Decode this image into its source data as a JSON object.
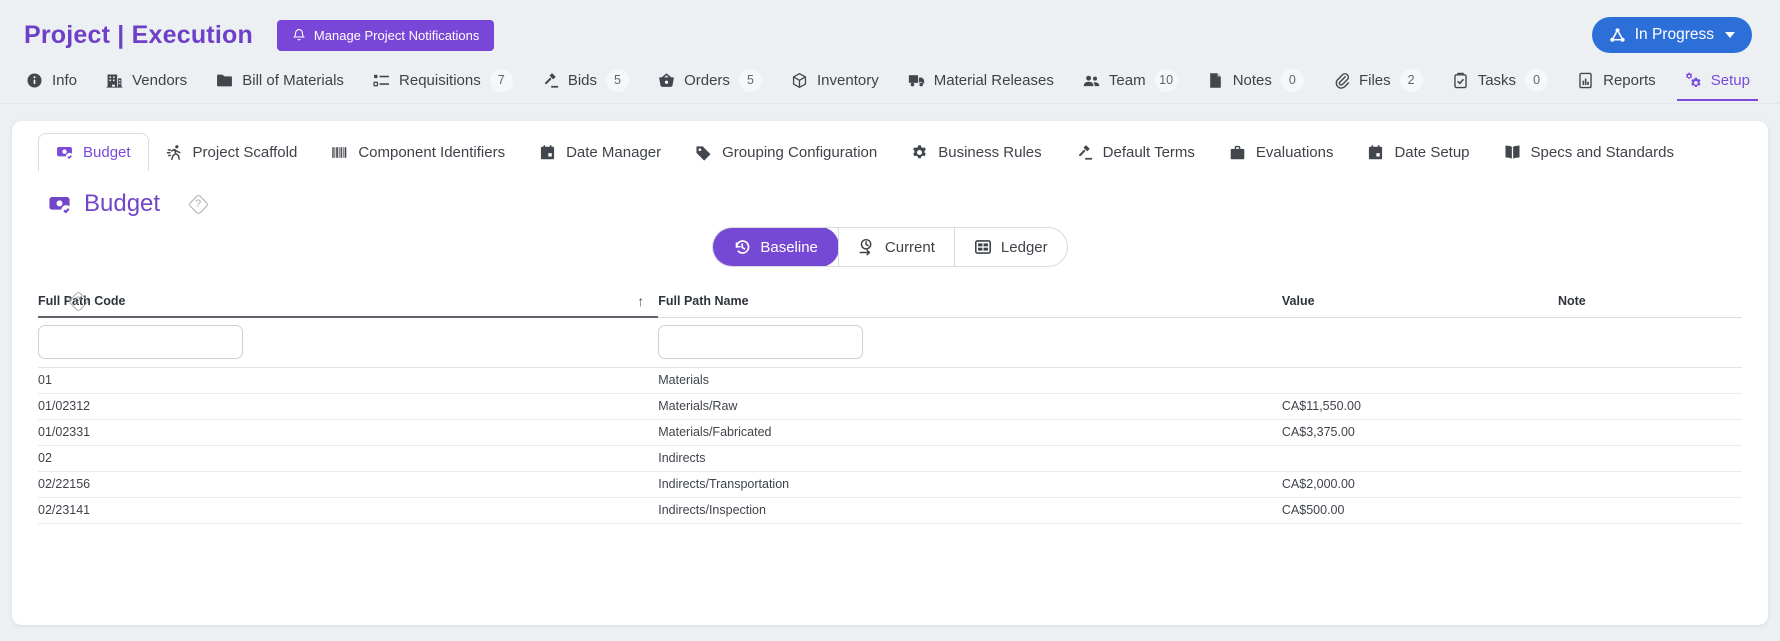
{
  "header": {
    "title": "Project | Execution",
    "notifications_button": "Manage Project Notifications",
    "status_button": "In Progress"
  },
  "colors": {
    "accent_purple": "#7649d4",
    "title_purple": "#6e40c8",
    "status_blue": "#2d6fd9"
  },
  "icons": {
    "help_glyph": "?"
  },
  "nav": {
    "items": [
      {
        "label": "Info",
        "icon": "info-icon"
      },
      {
        "label": "Vendors",
        "icon": "building-icon"
      },
      {
        "label": "Bill of Materials",
        "icon": "folder-icon"
      },
      {
        "label": "Requisitions",
        "icon": "checklist-icon",
        "badge": "7"
      },
      {
        "label": "Bids",
        "icon": "gavel-icon",
        "badge": "5"
      },
      {
        "label": "Orders",
        "icon": "basket-icon",
        "badge": "5"
      },
      {
        "label": "Inventory",
        "icon": "cube-icon"
      },
      {
        "label": "Material Releases",
        "icon": "truck-icon"
      },
      {
        "label": "Team",
        "icon": "people-icon",
        "badge": "10"
      },
      {
        "label": "Notes",
        "icon": "document-icon",
        "badge": "0"
      },
      {
        "label": "Files",
        "icon": "paperclip-icon",
        "badge": "2"
      },
      {
        "label": "Tasks",
        "icon": "clipboard-check-icon",
        "badge": "0"
      },
      {
        "label": "Reports",
        "icon": "report-icon"
      },
      {
        "label": "Setup",
        "icon": "gears-icon",
        "active": true
      }
    ]
  },
  "subtabs": [
    {
      "label": "Budget",
      "icon": "budget-icon",
      "active": true
    },
    {
      "label": "Project Scaffold",
      "icon": "runner-icon"
    },
    {
      "label": "Component Identifiers",
      "icon": "barcode-icon"
    },
    {
      "label": "Date Manager",
      "icon": "calendar-icon"
    },
    {
      "label": "Grouping Configuration",
      "icon": "tag-icon"
    },
    {
      "label": "Business Rules",
      "icon": "gear-icon"
    },
    {
      "label": "Default Terms",
      "icon": "gavel-icon"
    },
    {
      "label": "Evaluations",
      "icon": "briefcase-icon"
    },
    {
      "label": "Date Setup",
      "icon": "calendar-icon"
    },
    {
      "label": "Specs and Standards",
      "icon": "book-icon"
    }
  ],
  "page": {
    "title": "Budget"
  },
  "view_toggle": {
    "options": [
      {
        "label": "Baseline",
        "icon": "history-icon",
        "active": true
      },
      {
        "label": "Current",
        "icon": "clock-forward-icon"
      },
      {
        "label": "Ledger",
        "icon": "grid-icon"
      }
    ]
  },
  "table": {
    "columns": [
      "Full Path Code",
      "Full Path Name",
      "Value",
      "Note"
    ],
    "sort_column": "Full Path Code",
    "sort_direction": "asc",
    "sort_indicator": "↑",
    "filters": [
      {
        "column": "Full Path Code",
        "value": ""
      },
      {
        "column": "Full Path Name",
        "value": ""
      }
    ],
    "rows": [
      {
        "code": "01",
        "name": "Materials",
        "value": "",
        "note": ""
      },
      {
        "code": "01/02312",
        "name": "Materials/Raw",
        "value": "CA$11,550.00",
        "note": ""
      },
      {
        "code": "01/02331",
        "name": "Materials/Fabricated",
        "value": "CA$3,375.00",
        "note": ""
      },
      {
        "code": "02",
        "name": "Indirects",
        "value": "",
        "note": ""
      },
      {
        "code": "02/22156",
        "name": "Indirects/Transportation",
        "value": "CA$2,000.00",
        "note": ""
      },
      {
        "code": "02/23141",
        "name": "Indirects/Inspection",
        "value": "CA$500.00",
        "note": ""
      }
    ]
  }
}
